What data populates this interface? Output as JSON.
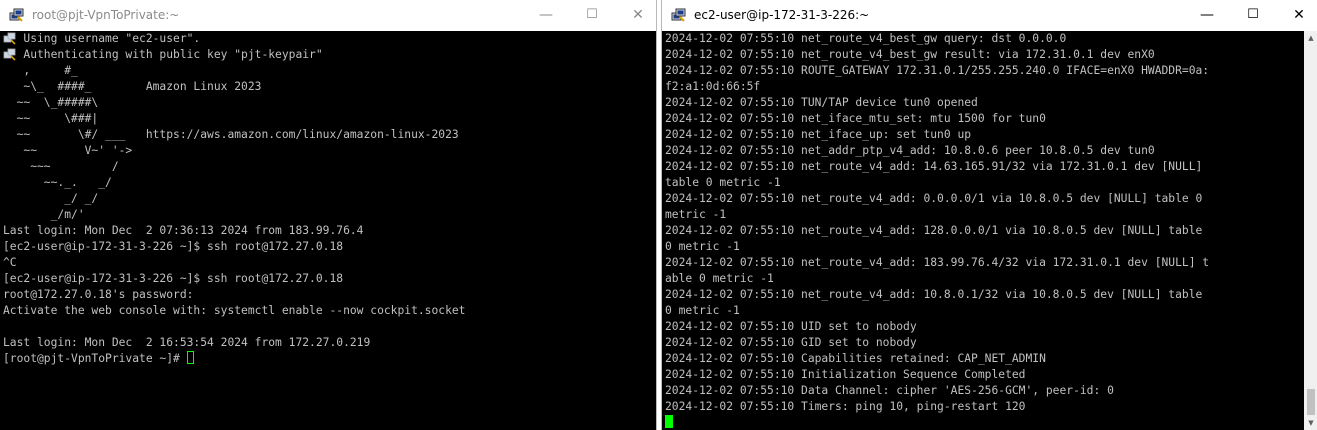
{
  "left_window": {
    "title": "root@pjt-VpnToPrivate:~",
    "controls": {
      "minimize": "—",
      "maximize": "☐",
      "close": "✕"
    },
    "lines": [
      "   Using username \"ec2-user\".",
      "   Authenticating with public key \"pjt-keypair\"",
      "   ,     #_",
      "   ~\\_  ####_        Amazon Linux 2023",
      "  ~~  \\_#####\\",
      "  ~~     \\###|",
      "  ~~       \\#/ ___   https://aws.amazon.com/linux/amazon-linux-2023",
      "   ~~       V~' '->",
      "    ~~~         /",
      "      ~~._.   _/",
      "         _/ _/",
      "       _/m/'",
      "Last login: Mon Dec  2 07:36:13 2024 from 183.99.76.4",
      "[ec2-user@ip-172-31-3-226 ~]$ ssh root@172.27.0.18",
      "^C",
      "[ec2-user@ip-172-31-3-226 ~]$ ssh root@172.27.0.18",
      "root@172.27.0.18's password:",
      "Activate the web console with: systemctl enable --now cockpit.socket",
      "",
      "Last login: Mon Dec  2 16:53:54 2024 from 172.27.0.219"
    ],
    "prompt": "[root@pjt-VpnToPrivate ~]# "
  },
  "right_window": {
    "title": "ec2-user@ip-172-31-3-226:~",
    "controls": {
      "minimize": "—",
      "maximize": "☐",
      "close": "✕"
    },
    "lines": [
      "2024-12-02 07:55:10 net_route_v4_best_gw query: dst 0.0.0.0",
      "2024-12-02 07:55:10 net_route_v4_best_gw result: via 172.31.0.1 dev enX0",
      "2024-12-02 07:55:10 ROUTE_GATEWAY 172.31.0.1/255.255.240.0 IFACE=enX0 HWADDR=0a:",
      "f2:a1:0d:66:5f",
      "2024-12-02 07:55:10 TUN/TAP device tun0 opened",
      "2024-12-02 07:55:10 net_iface_mtu_set: mtu 1500 for tun0",
      "2024-12-02 07:55:10 net_iface_up: set tun0 up",
      "2024-12-02 07:55:10 net_addr_ptp_v4_add: 10.8.0.6 peer 10.8.0.5 dev tun0",
      "2024-12-02 07:55:10 net_route_v4_add: 14.63.165.91/32 via 172.31.0.1 dev [NULL]",
      "table 0 metric -1",
      "2024-12-02 07:55:10 net_route_v4_add: 0.0.0.0/1 via 10.8.0.5 dev [NULL] table 0",
      "metric -1",
      "2024-12-02 07:55:10 net_route_v4_add: 128.0.0.0/1 via 10.8.0.5 dev [NULL] table",
      "0 metric -1",
      "2024-12-02 07:55:10 net_route_v4_add: 183.99.76.4/32 via 172.31.0.1 dev [NULL] t",
      "able 0 metric -1",
      "2024-12-02 07:55:10 net_route_v4_add: 10.8.0.1/32 via 10.8.0.5 dev [NULL] table",
      "0 metric -1",
      "2024-12-02 07:55:10 UID set to nobody",
      "2024-12-02 07:55:10 GID set to nobody",
      "2024-12-02 07:55:10 Capabilities retained: CAP_NET_ADMIN",
      "2024-12-02 07:55:10 Initialization Sequence Completed",
      "2024-12-02 07:55:10 Data Channel: cipher 'AES-256-GCM', peer-id: 0",
      "2024-12-02 07:55:10 Timers: ping 10, ping-restart 120"
    ]
  },
  "colors": {
    "terminal_bg": "#000000",
    "terminal_fg": "#c0c0c0",
    "cursor": "#00ff00",
    "titlebar_bg": "#ffffff"
  },
  "icons": {
    "app": "putty-icon",
    "auth": "putty-key-icon"
  }
}
